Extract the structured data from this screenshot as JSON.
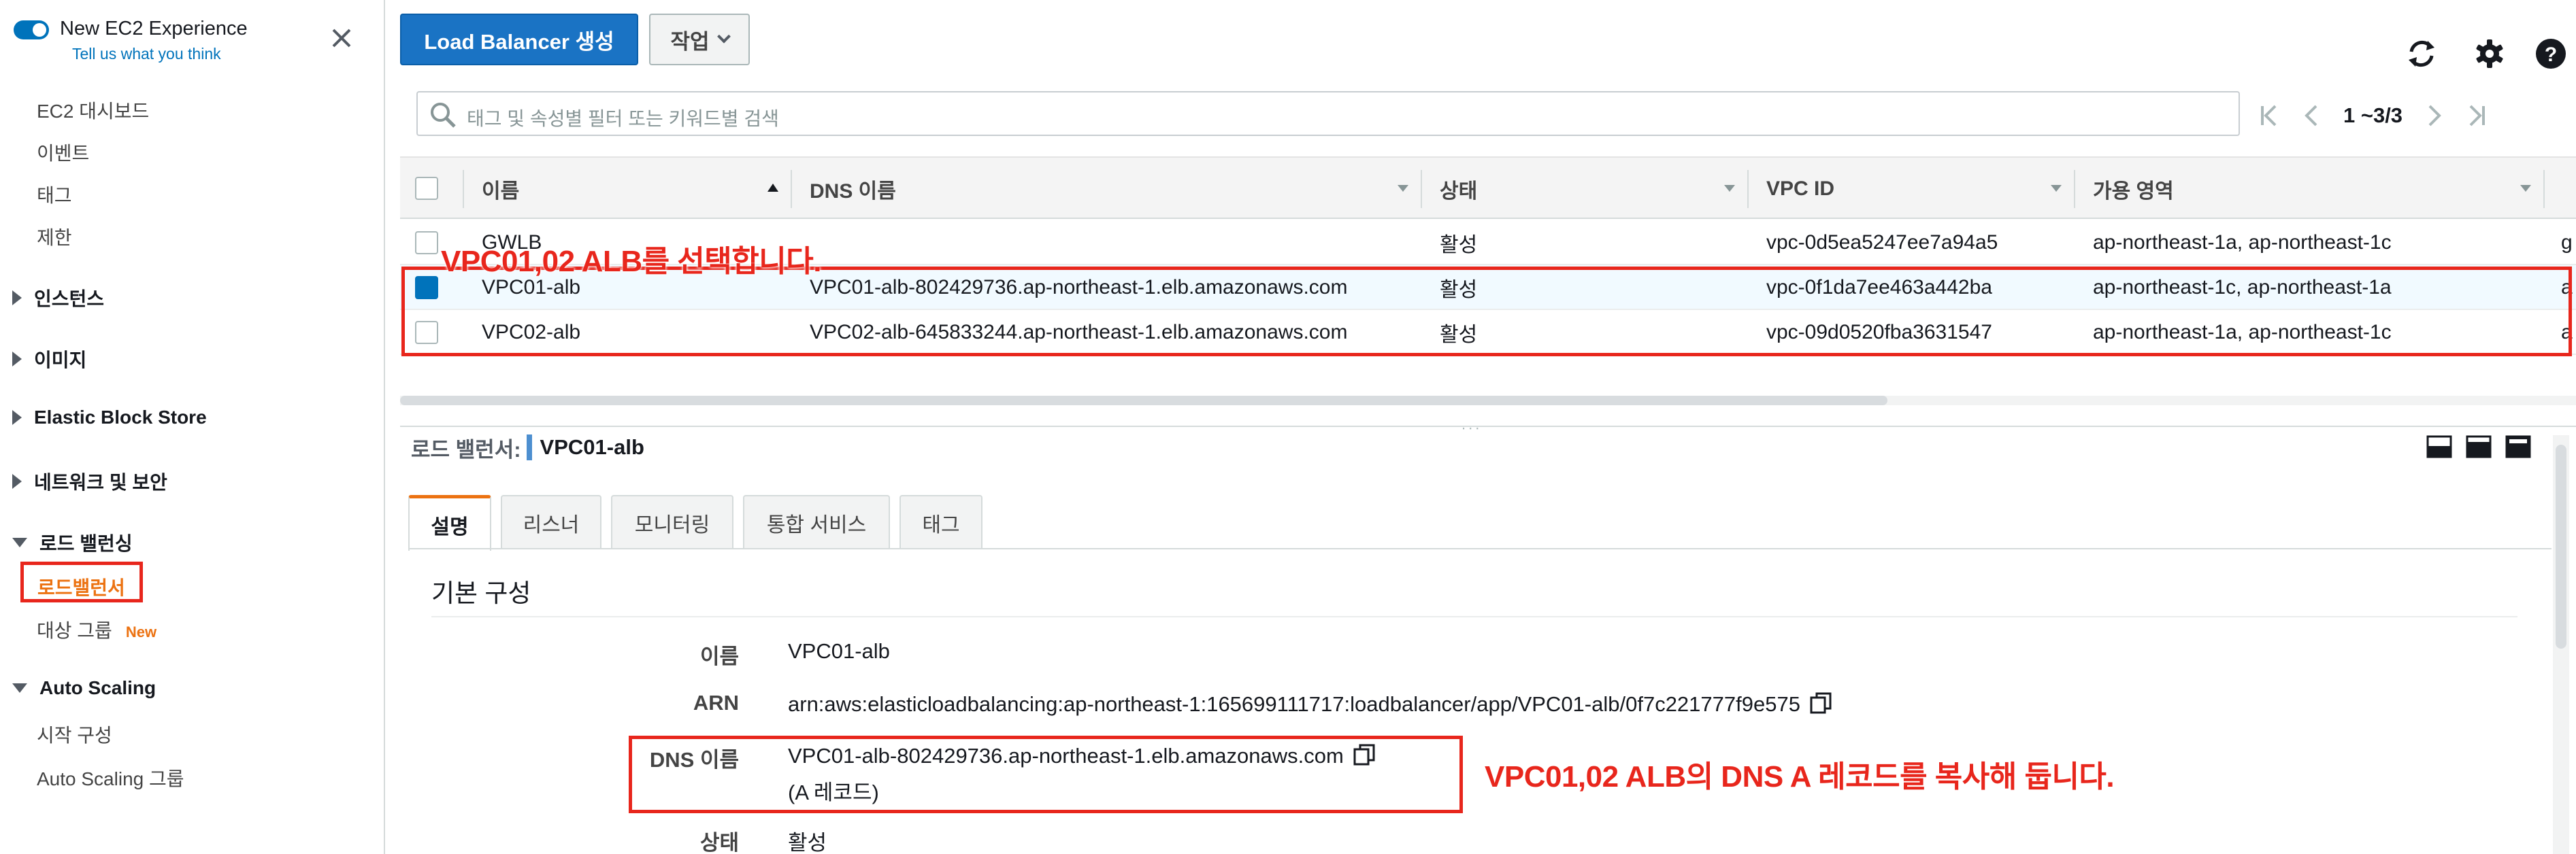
{
  "sidebar": {
    "experience_title": "New EC2 Experience",
    "experience_link": "Tell us what you think",
    "items": {
      "dashboard": "EC2 대시보드",
      "events": "이벤트",
      "tags": "태그",
      "limits": "제한",
      "instances": "인스턴스",
      "images": "이미지",
      "ebs": "Elastic Block Store",
      "network": "네트워크 및 보안",
      "load_balancing": "로드 밸런싱",
      "load_balancers": "로드밸런서",
      "target_groups": "대상 그룹",
      "target_groups_badge": "New",
      "auto_scaling": "Auto Scaling",
      "launch_config": "시작 구성",
      "asg": "Auto Scaling 그룹"
    }
  },
  "toolbar": {
    "create_label": "Load Balancer 생성",
    "actions_label": "작업"
  },
  "search": {
    "placeholder": "태그 및 속성별 필터 또는 키워드별 검색"
  },
  "pagination": {
    "text": "1 ~3/3"
  },
  "table": {
    "columns": [
      "이름",
      "DNS 이름",
      "상태",
      "VPC ID",
      "가용 영역"
    ],
    "rows": [
      {
        "name": "GWLB",
        "dns": "",
        "state": "활성",
        "vpc": "vpc-0d5ea5247ee7a94a5",
        "az": "ap-northeast-1a, ap-northeast-1c",
        "extra": "g"
      },
      {
        "name": "VPC01-alb",
        "dns": "VPC01-alb-802429736.ap-northeast-1.elb.amazonaws.com",
        "state": "활성",
        "vpc": "vpc-0f1da7ee463a442ba",
        "az": "ap-northeast-1c, ap-northeast-1a",
        "extra": "a"
      },
      {
        "name": "VPC02-alb",
        "dns": "VPC02-alb-645833244.ap-northeast-1.elb.amazonaws.com",
        "state": "활성",
        "vpc": "vpc-09d0520fba3631547",
        "az": "ap-northeast-1a, ap-northeast-1c",
        "extra": "a"
      }
    ]
  },
  "annotations": {
    "select_note": "VPC01,02 ALB를 선택합니다.",
    "copy_note": "VPC01,02 ALB의 DNS A 레코드를 복사해 둡니다."
  },
  "detail": {
    "label": "로드 밸런서:",
    "name": "VPC01-alb",
    "tabs": [
      "설명",
      "리스너",
      "모니터링",
      "통합 서비스",
      "태그"
    ],
    "section_title": "기본 구성",
    "fields": {
      "name_key": "이름",
      "name_val": "VPC01-alb",
      "arn_key": "ARN",
      "arn_val": "arn:aws:elasticloadbalancing:ap-northeast-1:165699111717:loadbalancer/app/VPC01-alb/0f7c221777f9e575",
      "dns_key": "DNS 이름",
      "dns_val": "VPC01-alb-802429736.ap-northeast-1.elb.amazonaws.com",
      "dns_note": "(A 레코드)",
      "state_key": "상태",
      "state_val": "활성"
    }
  },
  "colors": {
    "primary": "#1a73c4",
    "accent_orange": "#ec7211",
    "annotation_red": "#e8261c",
    "link_blue": "#0073bb"
  }
}
